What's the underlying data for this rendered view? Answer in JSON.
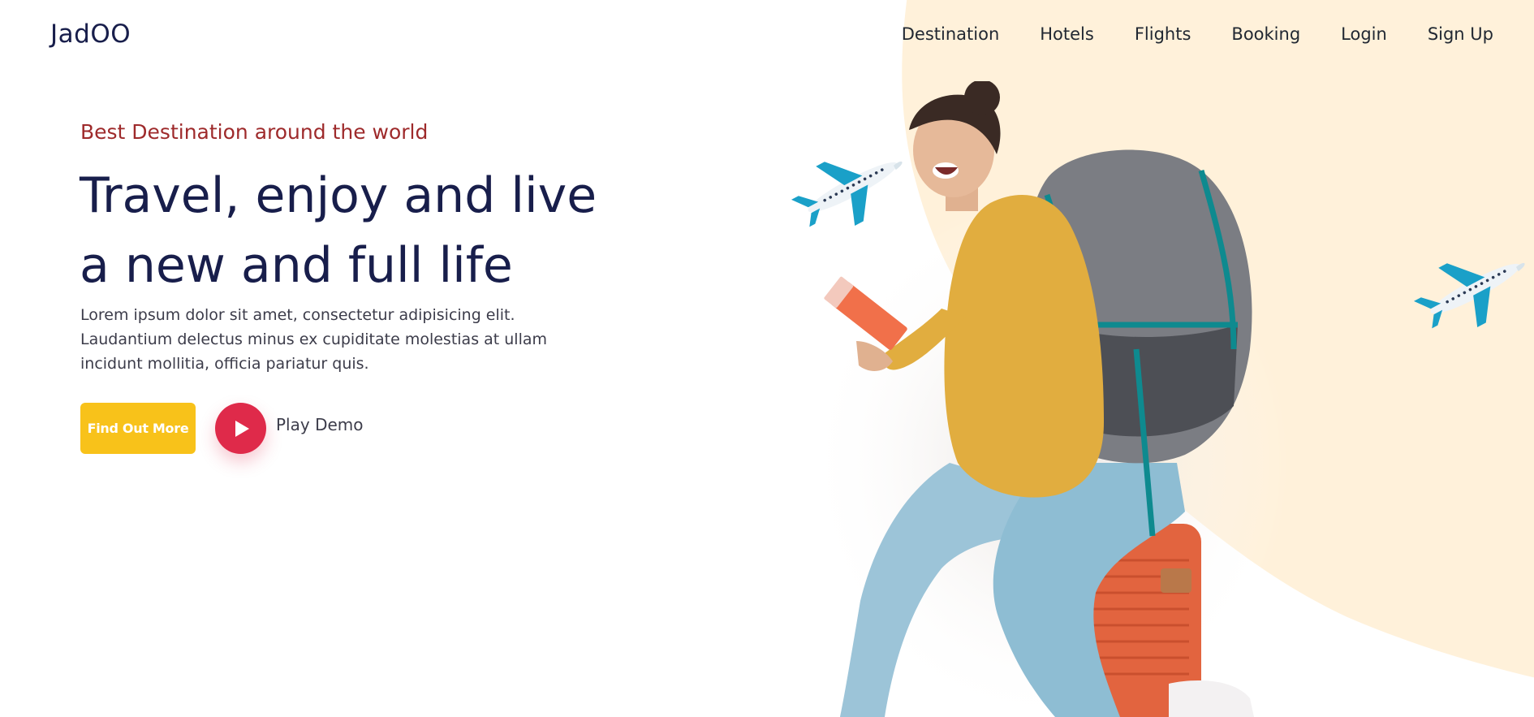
{
  "header": {
    "logo": "JadOO",
    "nav": [
      {
        "label": "Destination"
      },
      {
        "label": "Hotels"
      },
      {
        "label": "Flights"
      },
      {
        "label": "Booking"
      },
      {
        "label": "Login"
      },
      {
        "label": "Sign Up"
      }
    ]
  },
  "hero": {
    "eyebrow": "Best Destination around the world",
    "headline_line1": "Travel, enjoy and live",
    "headline_line2": "a new and full life",
    "description_line1": "Lorem ipsum dolor sit amet, consectetur adipisicing elit.",
    "description_line2": "Laudantium delectus minus ex cupiditate molestias at ullam",
    "description_line3": "incidunt mollitia, officia pariatur quis.",
    "cta_label": "Find Out More",
    "play_label": "Play Demo"
  },
  "colors": {
    "eyebrow": "#9e2a2b",
    "headline": "#181e4b",
    "cta": "#f8c21a",
    "play": "#df2a4a",
    "blob": "#fff1da"
  },
  "icons": {
    "play": "play-icon",
    "plane": "airplane-icon"
  }
}
